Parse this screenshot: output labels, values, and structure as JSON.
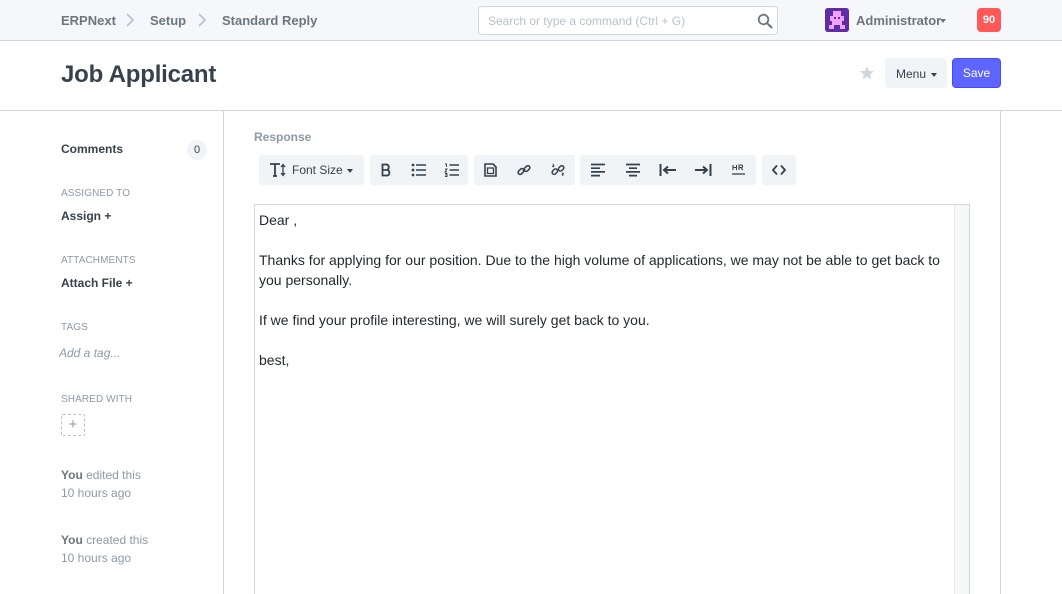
{
  "navbar": {
    "breadcrumbs": [
      "ERPNext",
      "Setup",
      "Standard Reply"
    ],
    "search_placeholder": "Search or type a command (Ctrl + G)",
    "search_icon": "search-icon",
    "user_name": "Administrator",
    "notification_count": "90",
    "accent_color": "#ff5858"
  },
  "page": {
    "title": "Job Applicant",
    "menu_label": "Menu",
    "save_label": "Save",
    "primary_color": "#5e64ff"
  },
  "sidebar": {
    "comments_label": "Comments",
    "comments_count": "0",
    "assigned_to_label": "ASSIGNED TO",
    "assign_link": "Assign +",
    "attachments_label": "ATTACHMENTS",
    "attach_link": "Attach File +",
    "tags_label": "TAGS",
    "tag_placeholder": "Add a tag...",
    "shared_with_label": "SHARED WITH",
    "share_add": "+",
    "timeline": [
      {
        "user": "You",
        "action": " edited this",
        "time": "10 hours ago"
      },
      {
        "user": "You",
        "action": " created this",
        "time": "10 hours ago"
      }
    ]
  },
  "form": {
    "field_label": "Response",
    "toolbar": {
      "font_size_label": "Font Size",
      "groups": [
        [
          "text-height-icon"
        ],
        [
          "bold-icon",
          "unordered-list-icon",
          "ordered-list-icon"
        ],
        [
          "picture-icon",
          "link-icon",
          "unlink-icon"
        ],
        [
          "align-left-icon",
          "align-center-icon",
          "outdent-icon",
          "indent-icon",
          "horizontal-rule-icon"
        ],
        [
          "code-icon"
        ]
      ]
    },
    "response_paragraphs": [
      "Dear ,",
      "Thanks for applying for our position. Due to the high volume of applications, we may not be able to get back to you personally.",
      "If we find your profile interesting, we will surely get back to you.",
      "best,"
    ]
  }
}
